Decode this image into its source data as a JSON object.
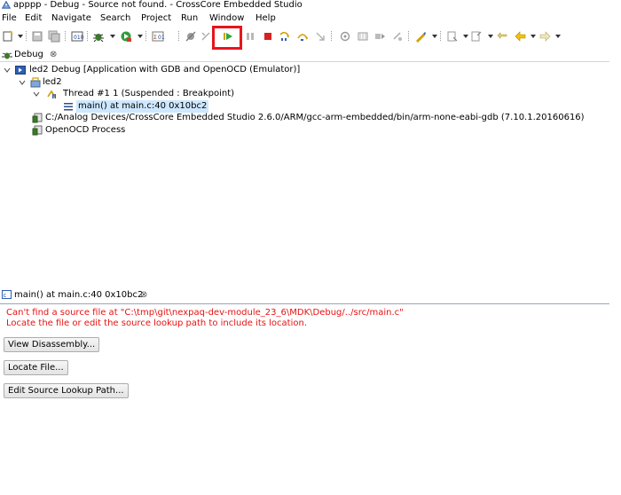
{
  "window": {
    "title": "apppp - Debug - Source not found. - CrossCore Embedded Studio"
  },
  "menu": [
    {
      "label": "File"
    },
    {
      "label": "Edit"
    },
    {
      "label": "Navigate"
    },
    {
      "label": "Search"
    },
    {
      "label": "Project"
    },
    {
      "label": "Run"
    },
    {
      "label": "Window"
    },
    {
      "label": "Help"
    }
  ],
  "toolbar": {
    "icons": [
      "new-icon",
      "save-icon",
      "save-all-icon",
      "build-icon",
      "debug-icon",
      "run-icon",
      "toggle-mode-icon",
      "skip-breakpoints-icon",
      "resume-icon",
      "suspend-icon",
      "terminate-icon",
      "step-into-icon",
      "step-over-icon",
      "step-return-icon",
      "back-icon",
      "forward-icon"
    ],
    "highlight_color": "#e8141c"
  },
  "debug_view": {
    "tab_label": "Debug",
    "close_symbol": "⊗",
    "tree": {
      "launch": "led2 Debug [Application with GDB and OpenOCD (Emulator)]",
      "target": "led2",
      "thread": "Thread #1 1 (Suspended : Breakpoint)",
      "frame": "main() at main.c:40 0x10bc2",
      "gdb_process": "C:/Analog Devices/CrossCore Embedded Studio 2.6.0/ARM/gcc-arm-embedded/bin/arm-none-eabi-gdb (7.10.1.20160616)",
      "openocd_process": "OpenOCD Process"
    }
  },
  "editor": {
    "tab_label": "main() at main.c:40 0x10bc2",
    "close_symbol": "⊗",
    "error_line1": "Can't find a source file at \"C:\\tmp\\git\\nexpaq-dev-module_23_6\\MDK\\Debug/../src/main.c\"",
    "error_line2": "Locate the file or edit the source lookup path to include its location.",
    "error_color": "#e81010",
    "buttons": {
      "view_disassembly": "View Disassembly...",
      "locate_file": "Locate File...",
      "edit_source_lookup": "Edit Source Lookup Path..."
    }
  }
}
